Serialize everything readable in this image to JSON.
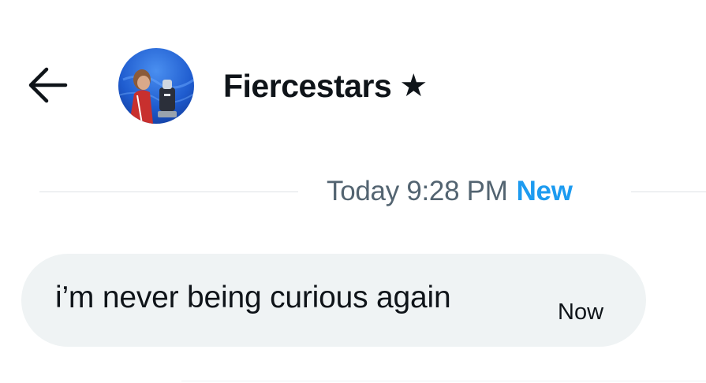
{
  "header": {
    "back_icon": "arrow-left-icon",
    "avatar_icon": "profile-avatar",
    "name": "Fiercestars",
    "badge": "★"
  },
  "conversation": {
    "divider": {
      "date_time": "Today 9:28 PM",
      "new_label": "New"
    },
    "messages": [
      {
        "text": "i’m never being curious again",
        "time": "Now"
      }
    ]
  },
  "colors": {
    "text_primary": "#0f1419",
    "text_secondary": "#536471",
    "accent": "#1d9bf0",
    "bubble_bg": "#eff3f4",
    "divider": "#dfe3e6"
  }
}
